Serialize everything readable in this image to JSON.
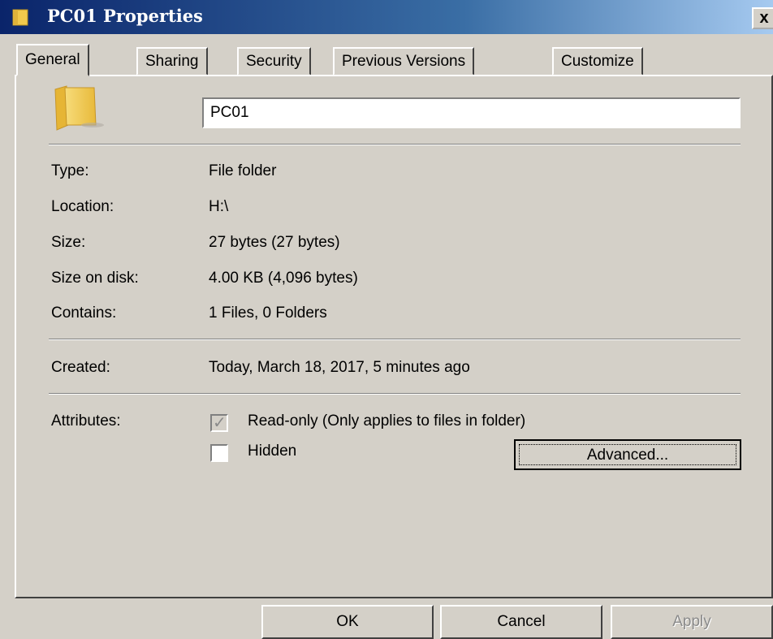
{
  "window": {
    "title": "PC01 Properties",
    "close_glyph": "x"
  },
  "tabs": [
    {
      "label": "General",
      "active": true
    },
    {
      "label": "Sharing",
      "active": false
    },
    {
      "label": "Security",
      "active": false
    },
    {
      "label": "Previous Versions",
      "active": false
    },
    {
      "label": "Customize",
      "active": false
    }
  ],
  "general": {
    "folder_name": "PC01",
    "icon": "folder-icon",
    "rows": {
      "type": {
        "label": "Type:",
        "value": "File folder"
      },
      "location": {
        "label": "Location:",
        "value": "H:\\"
      },
      "size": {
        "label": "Size:",
        "value": "27 bytes (27 bytes)"
      },
      "size_on_disk": {
        "label": "Size on disk:",
        "value": "4.00 KB (4,096 bytes)"
      },
      "contains": {
        "label": "Contains:",
        "value": "1 Files, 0 Folders"
      },
      "created": {
        "label": "Created:",
        "value": "Today, March 18, 2017, 5 minutes ago"
      }
    },
    "attributes": {
      "label": "Attributes:",
      "readonly": {
        "label": "Read-only (Only applies to files in folder)",
        "checked": true,
        "indeterminate_grey": true
      },
      "hidden": {
        "label": "Hidden",
        "checked": false
      },
      "advanced_button": "Advanced..."
    }
  },
  "footer": {
    "ok": "OK",
    "cancel": "Cancel",
    "apply": "Apply"
  },
  "colors": {
    "face": "#d4d0c8",
    "title_start": "#0a246a",
    "title_end": "#a6caf0",
    "disabled_text": "#8a8a8a"
  }
}
